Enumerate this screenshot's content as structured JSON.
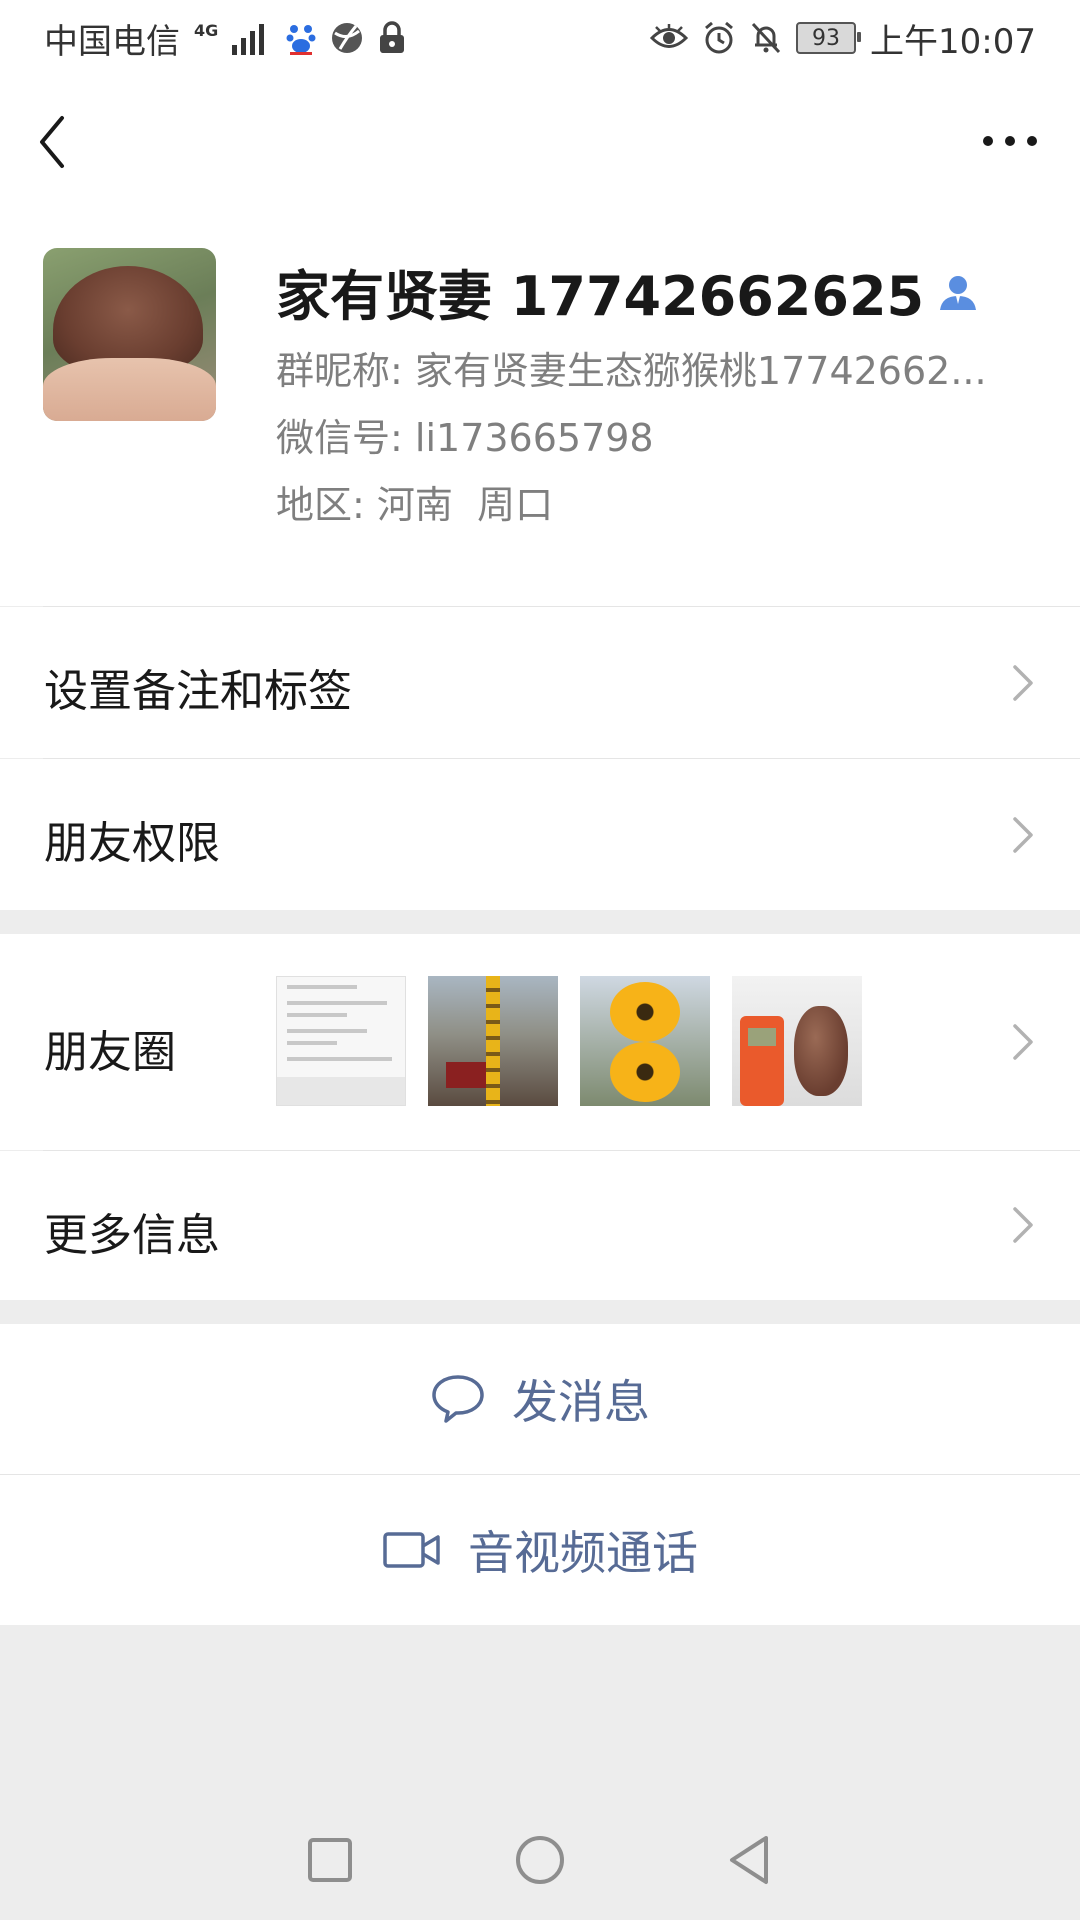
{
  "status_bar": {
    "carrier": "中国电信",
    "network": "4G",
    "battery": "93",
    "time": "上午10:07"
  },
  "profile": {
    "name": "家有贤妻 17742662625",
    "group_nickname_label": "群昵称:",
    "group_nickname": "家有贤妻生态猕猴桃17742662...",
    "wechat_id_label": "微信号:",
    "wechat_id": "li173665798",
    "region_label": "地区:",
    "region": "河南  周口"
  },
  "menu": {
    "remark": "设置备注和标签",
    "permission": "朋友权限",
    "moments": "朋友圈",
    "more_info": "更多信息"
  },
  "actions": {
    "message": "发消息",
    "call": "音视频通话"
  },
  "colors": {
    "link": "#576b95",
    "separator": "#ededed",
    "accent_icon": "#5a8ee0"
  }
}
